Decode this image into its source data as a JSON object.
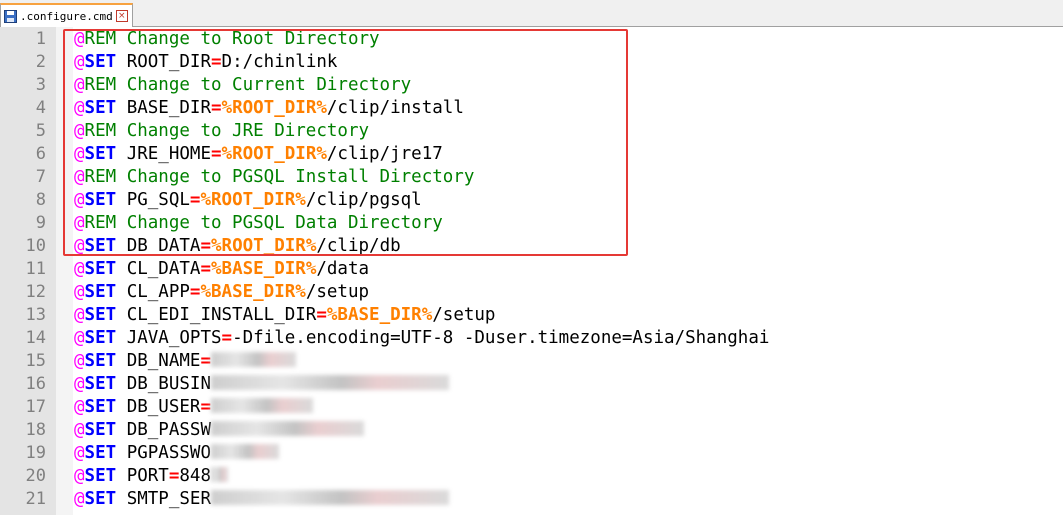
{
  "tab": {
    "title": ".configure.cmd",
    "close_glyph": "×"
  },
  "line_numbers": [
    "1",
    "2",
    "3",
    "4",
    "5",
    "6",
    "7",
    "8",
    "9",
    "10",
    "11",
    "12",
    "13",
    "14",
    "15",
    "16",
    "17",
    "18",
    "19",
    "20",
    "21"
  ],
  "lines": [
    {
      "at": "@",
      "kw": "REM",
      "rest": " Change to Root Directory"
    },
    {
      "at": "@",
      "kw": "SET",
      "name": " ROOT_DIR",
      "eq": "=",
      "val": "D:/chinlink"
    },
    {
      "at": "@",
      "kw": "REM",
      "rest": " Change to Current Directory"
    },
    {
      "at": "@",
      "kw": "SET",
      "name": " BASE_DIR",
      "eq": "=",
      "var": "%ROOT_DIR%",
      "val": "/clip/install"
    },
    {
      "at": "@",
      "kw": "REM",
      "rest": " Change to JRE Directory"
    },
    {
      "at": "@",
      "kw": "SET",
      "name": " JRE_HOME",
      "eq": "=",
      "var": "%ROOT_DIR%",
      "val": "/clip/jre17"
    },
    {
      "at": "@",
      "kw": "REM",
      "rest": " Change to PGSQL Install Directory"
    },
    {
      "at": "@",
      "kw": "SET",
      "name": " PG_SQL",
      "eq": "=",
      "var": "%ROOT_DIR%",
      "val": "/clip/pgsql"
    },
    {
      "at": "@",
      "kw": "REM",
      "rest": " Change to PGSQL Data Directory"
    },
    {
      "at": "@",
      "kw": "SET",
      "name": " DB_DATA",
      "eq": "=",
      "var": "%ROOT_DIR%",
      "val": "/clip/db"
    },
    {
      "at": "@",
      "kw": "SET",
      "name": " CL_DATA",
      "eq": "=",
      "var": "%BASE_DIR%",
      "val": "/data"
    },
    {
      "at": "@",
      "kw": "SET",
      "name": " CL_APP",
      "eq": "=",
      "var": "%BASE_DIR%",
      "val": "/setup"
    },
    {
      "at": "@",
      "kw": "SET",
      "name": " CL_EDI_INSTALL_DIR",
      "eq": "=",
      "var": "%BASE_DIR%",
      "val": "/setup"
    },
    {
      "at": "@",
      "kw": "SET",
      "name": " JAVA_OPTS",
      "eq": "=",
      "val": "-Dfile.encoding=UTF-8 -Duser.timezone=Asia/Shanghai"
    },
    {
      "at": "@",
      "kw": "SET",
      "name": " DB_NAME",
      "eq": "=",
      "blur": 5
    },
    {
      "at": "@",
      "kw": "SET",
      "name": " DB_BUSIN",
      "blur": 14
    },
    {
      "at": "@",
      "kw": "SET",
      "name": " DB_USER",
      "eq": "=",
      "blur": 6
    },
    {
      "at": "@",
      "kw": "SET",
      "name": " DB_PASSW",
      "blur": 9
    },
    {
      "at": "@",
      "kw": "SET",
      "name": " PGPASSWO",
      "blur": 4
    },
    {
      "at": "@",
      "kw": "SET",
      "name": " PORT",
      "eq": "=",
      "val": "848",
      "blur": 1
    },
    {
      "at": "@",
      "kw": "SET",
      "name": " SMTP_SER",
      "blur": 14
    }
  ],
  "colors": {
    "at_sign": "#ff00ff",
    "keyword": "#0000ff",
    "comment": "#008000",
    "operator": "#ff0000",
    "variable": "#ff8000",
    "highlight_box": "#e53935"
  }
}
